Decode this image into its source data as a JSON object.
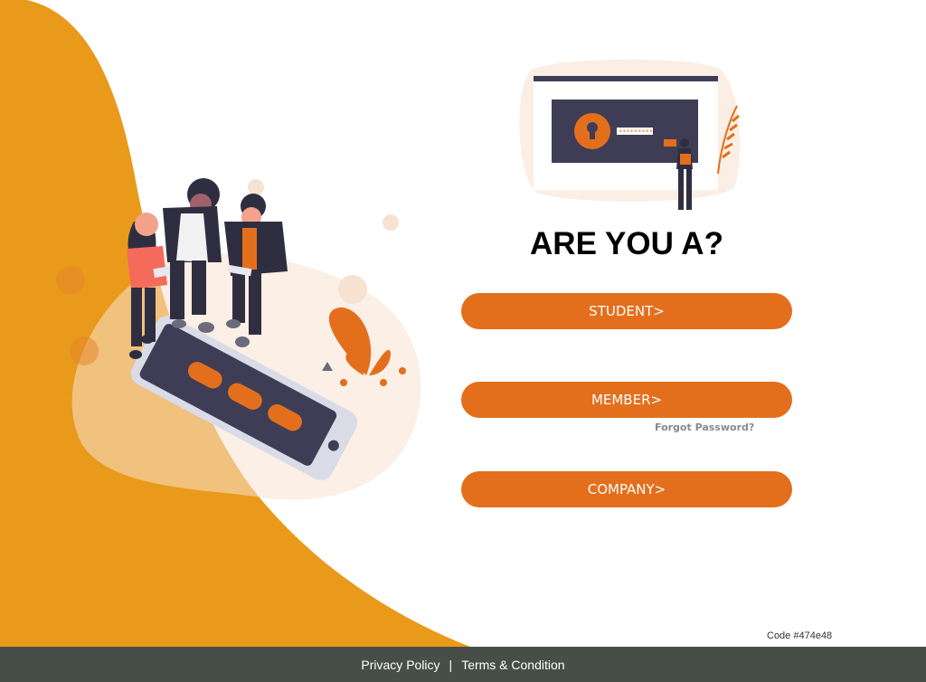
{
  "heading": "ARE YOU A?",
  "buttons": {
    "student": "STUDENT>",
    "member": "MEMBER>",
    "company": "COMPANY>"
  },
  "forgot_password": "Forgot Password?",
  "code_label": "Code #474e48",
  "footer": {
    "privacy": "Privacy Policy",
    "separator": "|",
    "terms": "Terms & Condition"
  },
  "colors": {
    "wave": "#e99a1a",
    "button": "#e36f1d",
    "footer": "#474e48",
    "ink": "#3f3d56"
  }
}
